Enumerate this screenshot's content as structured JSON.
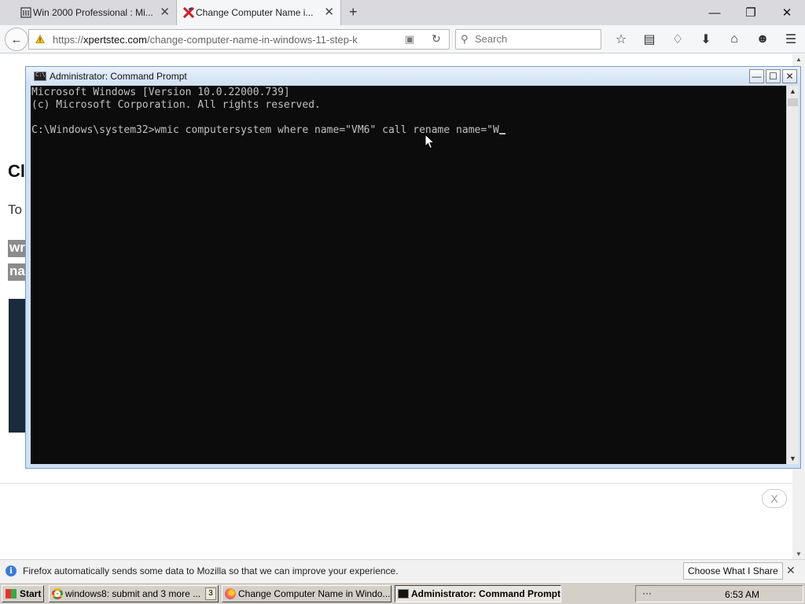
{
  "browser": {
    "tabs": [
      {
        "title": "Win 2000 Professional : Mi...",
        "active": false
      },
      {
        "title": "Change Computer Name i...",
        "active": true
      }
    ],
    "window_controls": {
      "minimize": "—",
      "restore": "❐",
      "close": "✕"
    },
    "url_domain": "xpertstec.com",
    "url_prefix": "https://",
    "url_path": "/change-computer-name-in-windows-11-step-k",
    "search_placeholder": "Search",
    "toolbar_icons": [
      "bookmark-star-icon",
      "library-icon",
      "pocket-icon",
      "download-icon",
      "home-icon",
      "smiley-icon",
      "menu-icon"
    ]
  },
  "page": {
    "heading_fragment": "Cl",
    "text_fragment": "To",
    "code_fragments": [
      "wr",
      "na"
    ],
    "ad_close_label": "X"
  },
  "cmd": {
    "title": "Administrator: Command Prompt",
    "lines": [
      "Microsoft Windows [Version 10.0.22000.739]",
      "(c) Microsoft Corporation. All rights reserved.",
      "",
      "C:\\Windows\\system32>wmic computersystem where name=\"VM6\" call rename name=\"W"
    ]
  },
  "notification": {
    "message": "Firefox automatically sends some data to Mozilla so that we can improve your experience.",
    "button_label": "Choose What I Share",
    "close_label": "✕"
  },
  "taskbar": {
    "start_label": "Start",
    "buttons": [
      {
        "label": "windows8: submit and 3 more ...",
        "count": "3",
        "active": false
      },
      {
        "label": "Change Computer Name in Windo...",
        "active": false
      },
      {
        "label": "Administrator: Command Prompt",
        "active": true
      }
    ],
    "tray_dots": "···",
    "clock": "6:53 AM"
  },
  "colors": {
    "console_bg": "#0c0c0c",
    "console_fg": "#c0c0c0",
    "taskbar_bg": "#d4d0c8",
    "cmd_frame": "#cfe0f3"
  }
}
